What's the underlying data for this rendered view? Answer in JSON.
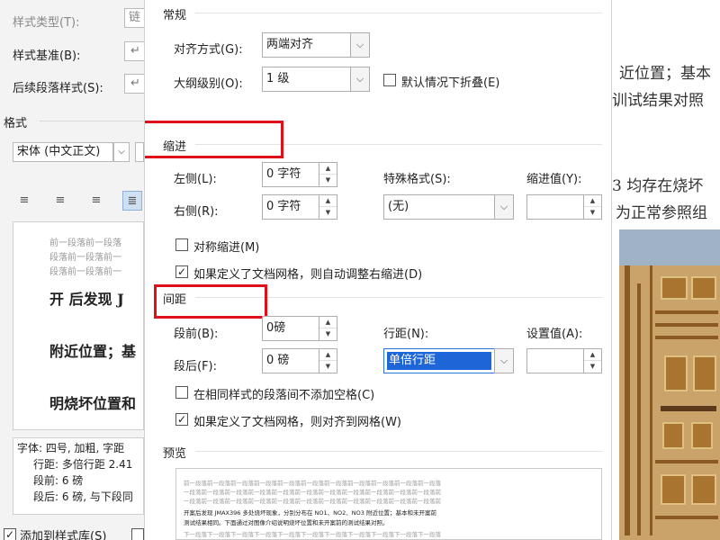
{
  "left_panel": {
    "style_type_label": "样式类型(T):",
    "style_type_value": "链",
    "style_base_label": "样式基准(B):",
    "style_base_value": "↵",
    "next_style_label": "后续段落样式(S):",
    "next_style_value": "↵",
    "format_label": "格式",
    "font_value": "宋体 (中文正文)",
    "preview_lines": [
      "前一段落前一段落",
      "段落前一段落前一",
      "段落前一段落前一"
    ],
    "preview_sample": [
      "开   后发现 J",
      "附近位置；基",
      "明烧坏位置和"
    ],
    "description_lines": [
      "字体: 四号, 加粗, 字距",
      "行距: 多倍行距 2.41",
      "段前: 6 磅",
      "段后: 6 磅, 与下段同"
    ],
    "add_to_gallery_label": "添加到样式库(S)"
  },
  "dialog": {
    "general_section": "常规",
    "alignment_label": "对齐方式(G):",
    "alignment_value": "两端对齐",
    "outline_label": "大纲级别(O):",
    "outline_value": "1 级",
    "collapse_default_label": "默认情况下折叠(E)",
    "indent_section": "缩进",
    "left_label": "左侧(L):",
    "left_value": "0 字符",
    "right_label": "右侧(R):",
    "right_value": "0 字符",
    "special_format_label": "特殊格式(S):",
    "special_format_value": "(无)",
    "indent_value_label": "缩进值(Y):",
    "indent_value_value": "",
    "mirror_indent_label": "对称缩进(M)",
    "auto_adjust_indent_label": "如果定义了文档网格，则自动调整右缩进(D)",
    "spacing_section": "间距",
    "before_label": "段前(B):",
    "before_value": "0磅",
    "after_label": "段后(F):",
    "after_value": "0 磅",
    "line_spacing_label": "行距(N):",
    "line_spacing_value": "单倍行距",
    "set_value_label": "设置值(A):",
    "set_value_value": "",
    "no_space_same_style_label": "在相同样式的段落间不添加空格(C)",
    "snap_to_grid_label": "如果定义了文档网格，则对齐到网格(W)",
    "preview_section": "预览",
    "preview_prev_lines": [
      "前一段落前一段落前一段落前一段落前一段落前一段落前一段落前一段落前一段落前一段落前一段落",
      "一段落前一段落前一段落前一段落前一段落前一段落前一段落前一段落前一段落前一段落前一段落前",
      "一段落前一段落前一段落前一段落前一段落前一段落前一段落前一段落前一段落前一段落前一段落前"
    ],
    "preview_main_lines": [
      "开案后发现 JMAX396 多处烧坏现象，分别分布在 NO1、NO2、NO3 附近位置；基本和未开案前",
      "测试结果相同。下面通过对图像介绍说明烧坏位置和未开案前的测试结果对照。"
    ],
    "preview_next_lines": [
      "下一段落下一段落下一段落下一段落下一段落下一段落下一段落下一段落下一段落下一段落下一段落"
    ]
  },
  "document": {
    "lines": [
      "近位置；基本",
      "训试结果对照",
      "3 均存在烧坏",
      "为正常参照组"
    ]
  },
  "colors": {
    "highlight": "#e0101a",
    "selection": "#1e66d8"
  }
}
